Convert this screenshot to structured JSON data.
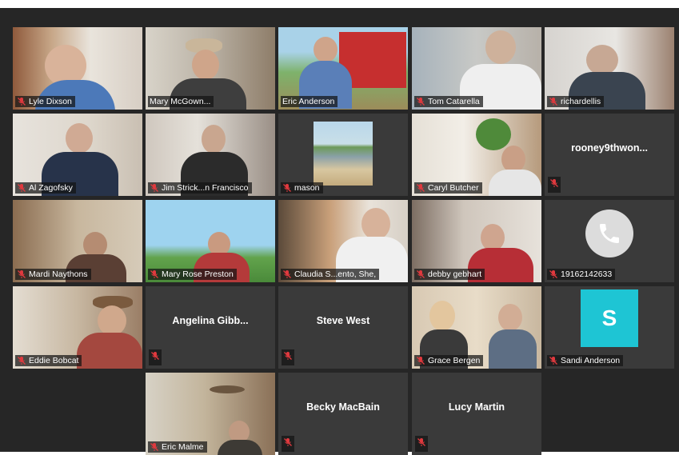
{
  "participants": [
    {
      "name": "Lyle Dixson",
      "type": "video",
      "active": false
    },
    {
      "name": "Mary McGown...",
      "type": "video",
      "active": false
    },
    {
      "name": "Eric Anderson",
      "type": "video",
      "active": true
    },
    {
      "name": "Tom Catarella",
      "type": "video",
      "active": false
    },
    {
      "name": "richardellis",
      "type": "video",
      "active": false
    },
    {
      "name": "Al Zagofsky",
      "type": "video",
      "active": false
    },
    {
      "name": "Jim Strick...n Francisco",
      "type": "video",
      "active": false
    },
    {
      "name": "mason",
      "type": "picture",
      "active": false
    },
    {
      "name": "Caryl Butcher",
      "type": "video",
      "active": false
    },
    {
      "name": "rooney9thwon...",
      "type": "name-only",
      "active": false
    },
    {
      "name": "Mardi Naythons",
      "type": "video",
      "active": false
    },
    {
      "name": "Mary Rose Preston",
      "type": "video",
      "active": false
    },
    {
      "name": "Claudia S...ento, She,",
      "type": "video",
      "active": false
    },
    {
      "name": "debby gebhart",
      "type": "video",
      "active": false
    },
    {
      "name": "19162142633",
      "type": "phone",
      "active": false
    },
    {
      "name": "Eddie Bobcat",
      "type": "video",
      "active": false
    },
    {
      "name": "Angelina Gibb...",
      "type": "name-only",
      "active": false
    },
    {
      "name": "Steve West",
      "type": "name-only",
      "active": false
    },
    {
      "name": "Grace Bergen",
      "type": "video",
      "active": false
    },
    {
      "name": "Sandi Anderson",
      "type": "avatar",
      "active": false,
      "avatar_letter": "S"
    },
    {
      "name": "Eric Malme",
      "type": "video",
      "active": false
    },
    {
      "name": "Becky MacBain",
      "type": "name-only",
      "active": false
    },
    {
      "name": "Lucy Martin",
      "type": "name-only",
      "active": false
    }
  ],
  "colors": {
    "background": "#262626",
    "tile": "#3a3a3a",
    "active_border": "#23d959",
    "muted_icon": "#e0393e",
    "avatar": "#1ec5d4"
  },
  "icons": {
    "muted": "mic-off-icon",
    "phone": "phone-icon"
  }
}
